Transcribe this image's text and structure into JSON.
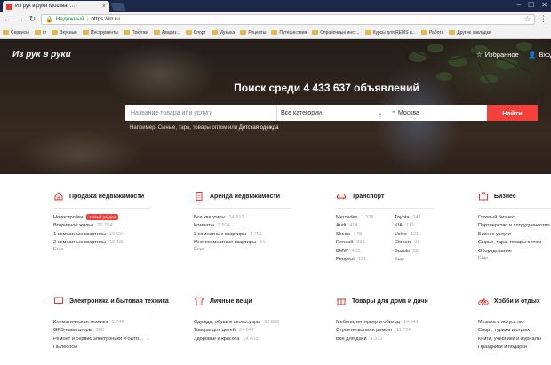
{
  "browser": {
    "tab_title": "Из рук в руки Москва: ...",
    "secure_label": "Надежный",
    "url": "https://irr.ru",
    "bookmarks": [
      "Сервисы",
      "irr",
      "Вкусные",
      "Инструменты",
      "Покупки",
      "Авариз...",
      "Спорт",
      "Музыка",
      "Рецепты",
      "Путешествия",
      "Справочные инст...",
      "Курсы для REMS и...",
      "Работа",
      "Другие закладки"
    ]
  },
  "header": {
    "logo": "Из рук в руки",
    "favorites": "Избранное",
    "login": "Вход"
  },
  "hero": {
    "title": "Поиск среди 4 433 637 объявлений",
    "search_placeholder": "Название товара или услуги",
    "category": "Все категории",
    "city": "Москва",
    "search_button": "Найти",
    "hint_prefix": "Например,",
    "hint_text": "Сыные, тара, товары оптом или",
    "hint_link": "Детская одежда"
  },
  "categories": [
    {
      "title": "Продажа недвижимости",
      "icon": "house-icon",
      "items": [
        {
          "label": "Новостройки",
          "badge": "Новый раздел"
        },
        {
          "label": "Вторичное жилье",
          "count": "22 754"
        },
        {
          "label": "1-комнатные квартиры",
          "count": "10 624"
        },
        {
          "label": "2-комнатные квартиры",
          "count": "10 180"
        }
      ],
      "more": "Еще"
    },
    {
      "title": "Аренда недвижимости",
      "icon": "building-icon",
      "items": [
        {
          "label": "Все квартиры",
          "count": "14 813"
        },
        {
          "label": "Комнаты",
          "count": "3 504"
        },
        {
          "label": "3-комнатные квартиры",
          "count": "1 755"
        },
        {
          "label": "Многокомнатные квартиры",
          "count": "34"
        }
      ],
      "more": "Еще"
    },
    {
      "title": "Транспорт",
      "icon": "car-icon",
      "pairs": [
        [
          {
            "label": "Mercedes",
            "count": "1 338"
          },
          {
            "label": "Toyota",
            "count": "141"
          }
        ],
        [
          {
            "label": "Audi",
            "count": "414"
          },
          {
            "label": "KIA",
            "count": "112"
          }
        ],
        [
          {
            "label": "Skoda",
            "count": "178"
          },
          {
            "label": "Volvo",
            "count": "101"
          }
        ],
        [
          {
            "label": "Renault",
            "count": "338"
          },
          {
            "label": "Citroen",
            "count": "98"
          }
        ],
        [
          {
            "label": "BMW",
            "count": "463"
          },
          {
            "label": "Suzuki",
            "count": "58"
          }
        ],
        [
          {
            "label": "Peugeot",
            "count": "121"
          },
          {
            "label": "Еще",
            "count": ""
          }
        ]
      ]
    },
    {
      "title": "Бизнес",
      "icon": "briefcase-icon",
      "items": [
        {
          "label": "Готовый бизнес"
        },
        {
          "label": "Партнерство и сотрудничество"
        },
        {
          "label": "Бизнес услуги"
        },
        {
          "label": "Сырье, тара, товары оптом"
        },
        {
          "label": "Оборудование"
        }
      ],
      "more": "Еще"
    },
    {
      "title": "Электроника и бытовая техника",
      "icon": "tv-icon",
      "items": [
        {
          "label": "Климатическая техника",
          "count": "1 749"
        },
        {
          "label": "GPS-навигаторы",
          "count": "308"
        },
        {
          "label": "Ремонт и сервис электроники и быто...",
          "count": "1"
        },
        {
          "label": "Пылесосы"
        }
      ]
    },
    {
      "title": "Личные вещи",
      "icon": "shirt-icon",
      "items": [
        {
          "label": "Одежда, обувь и аксессуары",
          "count": "32 806"
        },
        {
          "label": "Товары для детей",
          "count": "24 647"
        },
        {
          "label": "Здоровье и красота",
          "count": "14 403"
        }
      ]
    },
    {
      "title": "Товары для дома и дачи",
      "icon": "home-goods-icon",
      "items": [
        {
          "label": "Мебель, интерьер и обиход",
          "count": "14 941"
        },
        {
          "label": "Строительство и ремонт",
          "count": "11 736"
        },
        {
          "label": "Все для дачи",
          "count": "1 331"
        }
      ]
    },
    {
      "title": "Хобби и отдых",
      "icon": "bicycle-icon",
      "items": [
        {
          "label": "Музыка и искусство"
        },
        {
          "label": "Спорт, туризм и отдых"
        },
        {
          "label": "Книги, учебники и журналы"
        },
        {
          "label": "Праздники и подарки"
        }
      ]
    }
  ]
}
